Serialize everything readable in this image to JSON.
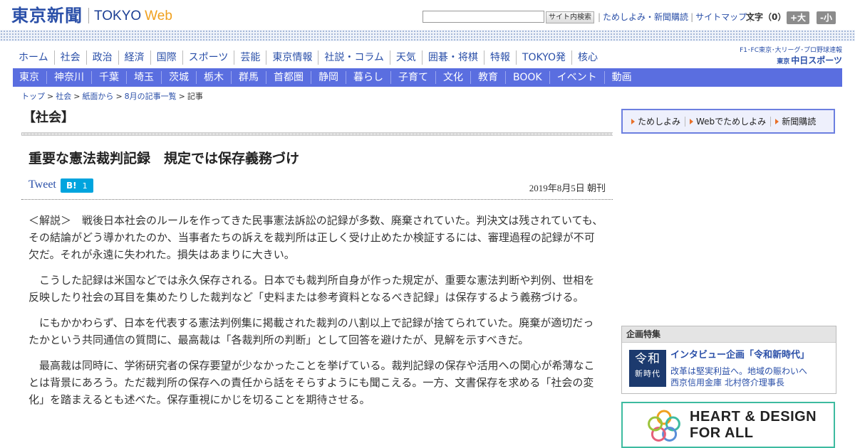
{
  "header": {
    "logo_jp": "東京新聞",
    "logo_tokyo": "TOKYO",
    "logo_web": "Web",
    "search_placeholder": "",
    "search_button": "サイト内検索",
    "util_links": [
      "ためしよみ・新聞購読",
      "サイトマップ"
    ],
    "font_label": "文字（0）",
    "font_bigger": "+大",
    "font_smaller": "-小"
  },
  "main_nav": [
    "ホーム",
    "社会",
    "政治",
    "経済",
    "国際",
    "スポーツ",
    "芸能",
    "東京情報",
    "社説・コラム",
    "天気",
    "囲碁・将棋",
    "特報",
    "TOKYO発",
    "核心"
  ],
  "chunichi": {
    "line1": "F1･FC東京･大リーグ･プロ野球速報",
    "prefix": "東京",
    "name": "中日スポーツ"
  },
  "region_nav": [
    "東京",
    "神奈川",
    "千葉",
    "埼玉",
    "茨城",
    "栃木",
    "群馬",
    "首都圏",
    "静岡",
    "暮らし",
    "子育て",
    "文化",
    "教育",
    "BOOK",
    "イベント",
    "動画"
  ],
  "breadcrumb": [
    "トップ",
    "社会",
    "紙面から",
    "8月の記事一覧",
    "記事"
  ],
  "article": {
    "section": "【社会】",
    "headline": "重要な憲法裁判記録　規定では保存義務づけ",
    "tweet": "Tweet",
    "hatena_label": "B!",
    "hatena_count": "1",
    "date": "2019年8月5日 朝刊",
    "paragraphs": [
      "＜解説＞　戦後日本社会のルールを作ってきた民事憲法訴訟の記録が多数、廃棄されていた。判決文は残されていても、その結論がどう導かれたのか、当事者たちの訴えを裁判所は正しく受け止めたか検証するには、審理過程の記録が不可欠だ。それが永遠に失われた。損失はあまりに大きい。",
      "　こうした記録は米国などでは永久保存される。日本でも裁判所自身が作った規定が、重要な憲法判断や判例、世相を反映したり社会の耳目を集めたりした裁判など「史料または参考資料となるべき記録」は保存するよう義務づける。",
      "　にもかかわらず、日本を代表する憲法判例集に掲載された裁判の八割以上で記録が捨てられていた。廃棄が適切だったかという共同通信の質問に、最高裁は「各裁判所の判断」として回答を避けたが、見解を示すべきだ。",
      "　最高裁は同時に、学術研究者の保存要望が少なかったことを挙げている。裁判記録の保存や活用への関心が希薄なことは背景にあろう。ただ裁判所の保存への責任から話をそらすようにも聞こえる。一方、文書保存を求める「社会の変化」を踏まえるとも述べた。保存重視にかじを切ることを期待させる。"
    ]
  },
  "subscription": [
    "ためしよみ",
    "Webでためしよみ",
    "新聞購読"
  ],
  "feature": {
    "heading": "企画特集",
    "badge_big": "令和",
    "badge_small": "新時代",
    "title": "インタビュー企画「令和新時代」",
    "desc_line1": "改革は堅実利益へ。地域の賑わいへ",
    "desc_line2": "西京信用金庫 北村啓介理事長"
  },
  "banner": {
    "line1": "HEART & DESIGN",
    "line2": "FOR ALL"
  },
  "colors": {
    "brand_blue": "#2a4fa8",
    "web_orange": "#f0a01e",
    "region_bar": "#5a6ee0",
    "hatena": "#00a4de",
    "banner_border": "#3dbba0"
  }
}
